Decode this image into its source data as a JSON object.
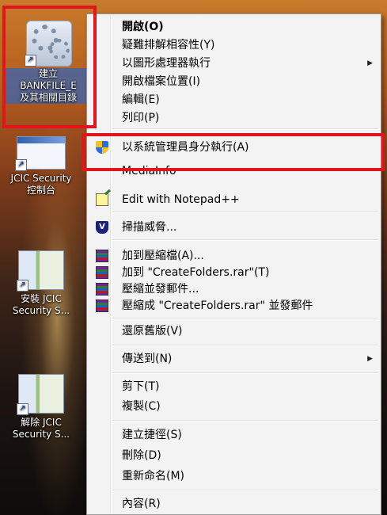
{
  "desktop": {
    "icons": [
      {
        "label": "建立\nBANKFILE_E\n及其相關目錄",
        "icon": "gear-settings-icon"
      },
      {
        "label": "JCIC Security\n控制台",
        "icon": "window-app-icon"
      },
      {
        "label": "安裝 JCIC\nSecurity S...",
        "icon": "installer-icon"
      },
      {
        "label": "解除 JCIC\nSecurity S...",
        "icon": "installer-icon"
      }
    ]
  },
  "context_menu": {
    "items": [
      {
        "label": "開啟(O)",
        "bold": true
      },
      {
        "label": "疑難排解相容性(Y)"
      },
      {
        "label": "以圖形處理器執行",
        "submenu": true
      },
      {
        "label": "開啟檔案位置(I)"
      },
      {
        "label": "編輯(E)"
      },
      {
        "label": "列印(P)"
      },
      {
        "label": "以系統管理員身分執行(A)",
        "icon": "uac-shield-icon"
      },
      {
        "label": "MediaInfo"
      },
      {
        "label": "Edit with Notepad++",
        "icon": "notepad-plus-plus-icon"
      },
      {
        "label": "掃描威脅...",
        "icon": "security-scan-icon"
      },
      {
        "label": "加到壓縮檔(A)...",
        "icon": "winrar-icon"
      },
      {
        "label": "加到 \"CreateFolders.rar\"(T)",
        "icon": "winrar-icon"
      },
      {
        "label": "壓縮並發郵件...",
        "icon": "winrar-icon"
      },
      {
        "label": "壓縮成 \"CreateFolders.rar\" 並發郵件",
        "icon": "winrar-icon"
      },
      {
        "label": "還原舊版(V)"
      },
      {
        "label": "傳送到(N)",
        "submenu": true
      },
      {
        "label": "剪下(T)"
      },
      {
        "label": "複製(C)"
      },
      {
        "label": "建立捷徑(S)"
      },
      {
        "label": "刪除(D)"
      },
      {
        "label": "重新命名(M)"
      },
      {
        "label": "內容(R)"
      }
    ],
    "submenu_arrow": "▶"
  },
  "highlight_color": "#e3141c"
}
